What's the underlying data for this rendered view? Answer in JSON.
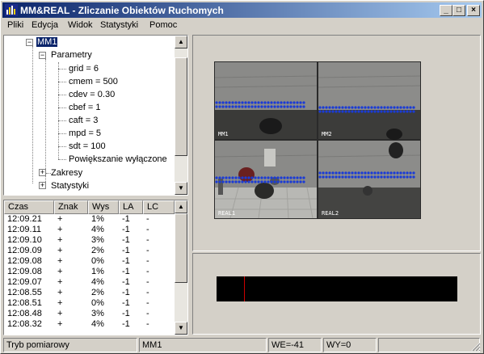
{
  "window": {
    "title": "MM&REAL - Zliczanie Obiektów Ruchomych",
    "minimize_glyph": "_",
    "maximize_glyph": "□",
    "close_glyph": "×"
  },
  "menu": [
    "Pliki",
    "Edycja",
    "Widok",
    "Statystyki",
    "Pomoc"
  ],
  "tree": {
    "root": "MM1",
    "parametry": "Parametry",
    "params": [
      "grid = 6",
      "cmem = 500",
      "cdev = 0.30",
      "cbef = 1",
      "caft = 3",
      "mpd = 5",
      "sdt = 100",
      "Powiększanie wyłączone"
    ],
    "zakresy": "Zakresy",
    "statystyki": "Statystyki"
  },
  "list": {
    "columns": [
      "Czas",
      "Znak",
      "Wys",
      "LA",
      "LC"
    ],
    "rows": [
      [
        "12:09.21",
        "+",
        "1%",
        "-1",
        "-"
      ],
      [
        "12:09.11",
        "+",
        "4%",
        "-1",
        "-"
      ],
      [
        "12:09.10",
        "+",
        "3%",
        "-1",
        "-"
      ],
      [
        "12:09.09",
        "+",
        "2%",
        "-1",
        "-"
      ],
      [
        "12:09.08",
        "+",
        "0%",
        "-1",
        "-"
      ],
      [
        "12:09.08",
        "+",
        "1%",
        "-1",
        "-"
      ],
      [
        "12:09.07",
        "+",
        "4%",
        "-1",
        "-"
      ],
      [
        "12:08.55",
        "+",
        "2%",
        "-1",
        "-"
      ],
      [
        "12:08.51",
        "+",
        "0%",
        "-1",
        "-"
      ],
      [
        "12:08.48",
        "+",
        "3%",
        "-1",
        "-"
      ],
      [
        "12:08.32",
        "+",
        "4%",
        "-1",
        "-"
      ]
    ]
  },
  "video": {
    "labels": [
      "MM1",
      "MM2",
      "REAL1",
      "REAL2"
    ]
  },
  "status": {
    "mode": "Tryb pomiarowy",
    "camera": "MM1",
    "we": "WE=-41",
    "wy": "WY=0"
  },
  "colors": {
    "title_start": "#0a246a",
    "title_end": "#a6caf0",
    "face": "#d4d0c8",
    "dots": "#1a3bd6",
    "marker": "#cc0000"
  }
}
